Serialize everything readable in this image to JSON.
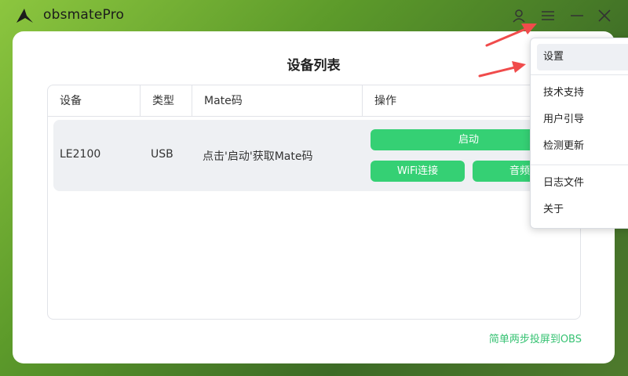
{
  "app": {
    "title": "obsmatePro"
  },
  "page": {
    "title": "设备列表"
  },
  "table": {
    "headers": [
      "设备",
      "类型",
      "Mate码",
      "操作"
    ],
    "rows": [
      {
        "device": "LE2100",
        "type": "USB",
        "mate_code": "点击'启动'获取Mate码",
        "actions": {
          "start": "启动",
          "wifi": "WiFi连接",
          "audio": "音频"
        }
      }
    ]
  },
  "footer": {
    "link": "简单两步投屏到OBS"
  },
  "menu": {
    "items": [
      "设置",
      "技术支持",
      "用户引导",
      "检测更新",
      "日志文件",
      "关于"
    ]
  },
  "colors": {
    "accent": "#35d074",
    "link": "#36c272",
    "annotation_arrow": "#f04b4b"
  },
  "icons": [
    "logo-icon",
    "user-icon",
    "menu-icon",
    "minimize-icon",
    "close-icon"
  ]
}
